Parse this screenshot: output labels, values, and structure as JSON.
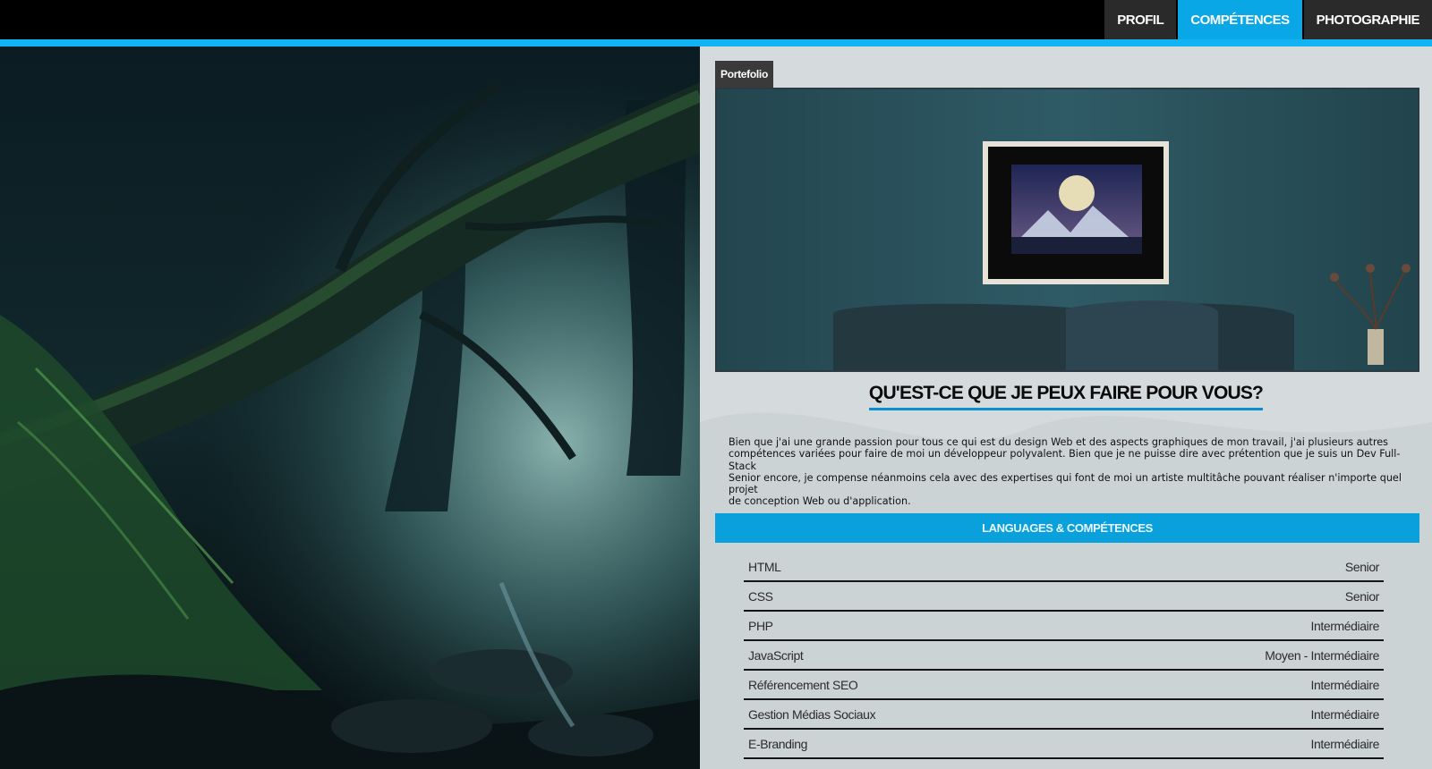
{
  "nav": {
    "items": [
      {
        "label": "PROFIL",
        "active": false
      },
      {
        "label": "COMPÉTENCES",
        "active": true
      },
      {
        "label": "PHOTOGRAPHIE",
        "active": false
      }
    ]
  },
  "colors": {
    "accent": "#12b3f2",
    "nav_active": "#0aa7e6",
    "nav_inactive": "#2a2a2a",
    "section_bar": "#0aa0dc",
    "panel_bg": "#d5dadd"
  },
  "left_panel": {
    "image": "forest-illustration"
  },
  "content": {
    "tab_label": "Portefolio",
    "hero_image": "framed-moon-artwork-above-sofa",
    "headline": "QU'EST-CE QUE JE PEUX FAIRE POUR VOUS?",
    "intro_lines": [
      "Bien que j'ai une grande passion pour tous ce qui est du design Web et des aspects graphiques de mon travail, j'ai plusieurs autres",
      "compétences variées pour faire de moi un développeur polyvalent. Bien que je ne puisse dire avec prétention que je suis un Dev Full-Stack",
      "Senior encore, je compense néanmoins cela avec des expertises qui font de moi un artiste multitâche pouvant réaliser n'importe quel projet",
      "de conception Web ou d'application."
    ],
    "section_title": "LANGUAGES & COMPÉTENCES",
    "skills": [
      {
        "name": "HTML",
        "level": "Senior"
      },
      {
        "name": "CSS",
        "level": "Senior"
      },
      {
        "name": "PHP",
        "level": "Intermédiaire"
      },
      {
        "name": "JavaScript",
        "level": "Moyen - Intermédiaire"
      },
      {
        "name": "Référencement SEO",
        "level": "Intermédiaire"
      },
      {
        "name": "Gestion Médias Sociaux",
        "level": "Intermédiaire"
      },
      {
        "name": "E-Branding",
        "level": "Intermédiaire"
      }
    ]
  }
}
